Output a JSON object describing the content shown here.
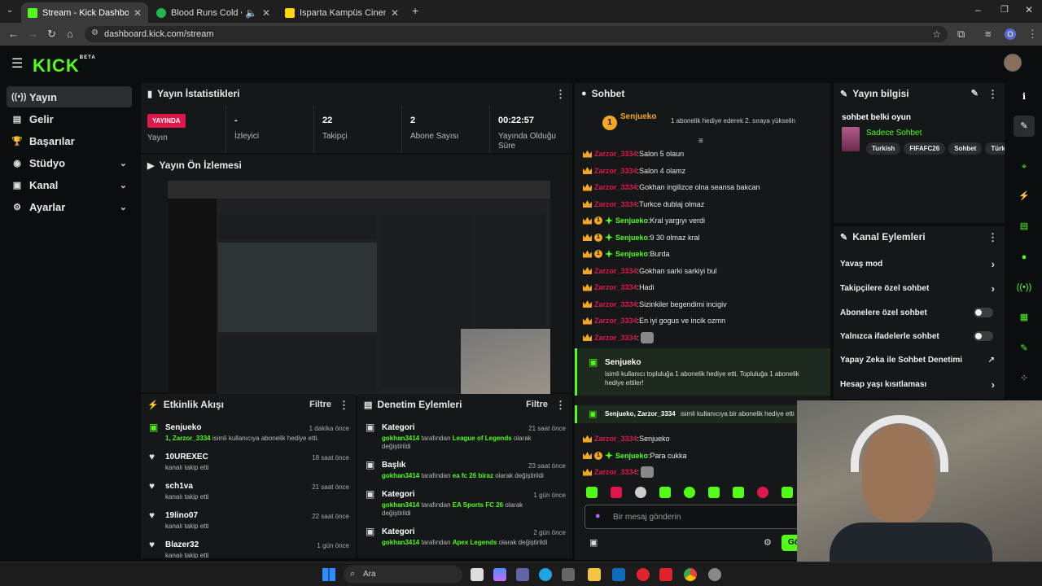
{
  "browser": {
    "tabs": [
      {
        "title": "Stream - Kick Dashboard",
        "color": "#53fc18"
      },
      {
        "title": "Blood Runs Cold • Jedi Mind",
        "color": "#1db954"
      },
      {
        "title": "Isparta Kampüs Cinema Pink | N",
        "color": "#f5d90a"
      }
    ],
    "url": "dashboard.kick.com/stream",
    "profile_initial": "O"
  },
  "kick": {
    "logo": "KICK",
    "logo_sup": "BETA"
  },
  "sidebar": {
    "items": [
      {
        "label": "Yayın"
      },
      {
        "label": "Gelir"
      },
      {
        "label": "Başarılar"
      },
      {
        "label": "Stüdyo"
      },
      {
        "label": "Kanal"
      },
      {
        "label": "Ayarlar"
      }
    ]
  },
  "stats": {
    "title": "Yayın İstatistikleri",
    "live_badge": "YAYINDA",
    "live_label": "Yayın",
    "cells": [
      {
        "value": "-",
        "label": "İzleyici"
      },
      {
        "value": "22",
        "label": "Takipçi"
      },
      {
        "value": "2",
        "label": "Abone Sayısı"
      },
      {
        "value": "00:22:57",
        "label": "Yayında Olduğu Süre"
      }
    ]
  },
  "preview": {
    "title": "Yayın Ön İzlemesi"
  },
  "activity": {
    "title": "Etkinlik Akışı",
    "filter": "Filtre",
    "items": [
      {
        "name": "Senjueko",
        "sub_green": "1, Zarzor_3334",
        "sub": "isimli kullanıcıya abonelik hediye etti.",
        "time": "1 dakika önce",
        "icon": "gift-icon"
      },
      {
        "name": "10UREXEC",
        "sub_green": "",
        "sub": "kanalı takip etti",
        "time": "18 saat önce",
        "icon": "heart-icon"
      },
      {
        "name": "sch1va",
        "sub_green": "",
        "sub": "kanalı takip etti",
        "time": "21 saat önce",
        "icon": "heart-icon"
      },
      {
        "name": "19lino07",
        "sub_green": "",
        "sub": "kanalı takip etti",
        "time": "22 saat önce",
        "icon": "heart-icon"
      },
      {
        "name": "Blazer32",
        "sub_green": "",
        "sub": "kanalı takip etti",
        "time": "1 gün önce",
        "icon": "heart-icon"
      }
    ]
  },
  "moderation": {
    "title": "Denetim Eylemleri",
    "filter": "Filtre",
    "items": [
      {
        "name": "Kategori",
        "user": "gokhan3414",
        "mid": "tarafından",
        "target": "League of Legends",
        "end": "olarak değiştirildi",
        "time": "21 saat önce"
      },
      {
        "name": "Başlık",
        "user": "gokhan3414",
        "mid": "tarafından",
        "target": "ea fc 26 biraz",
        "end": "olarak değiştirildi",
        "time": "23 saat önce"
      },
      {
        "name": "Kategori",
        "user": "gokhan3414",
        "mid": "tarafından",
        "target": "EA Sports FC 26",
        "end": "olarak değiştirildi",
        "time": "1 gün önce"
      },
      {
        "name": "Kategori",
        "user": "gokhan3414",
        "mid": "tarafından",
        "target": "Apex Legends",
        "end": "olarak değiştirildi",
        "time": "2 gün önce"
      }
    ]
  },
  "chat": {
    "title": "Sohbet",
    "pinned_user": "Senjueko",
    "pinned_rank": "1",
    "pinned_text": "1 abonelik hediye ederek 2. sıraya yükselin",
    "messages": [
      {
        "user": "Zarzor_3334",
        "type": "mod",
        "text": "Salon 5 olaun"
      },
      {
        "user": "Zarzor_3334",
        "type": "mod",
        "text": "Salon 4 olamz"
      },
      {
        "user": "Zarzor_3334",
        "type": "mod",
        "text": "Gokhan ingilizce olna seansa bakcan"
      },
      {
        "user": "Zarzor_3334",
        "type": "mod",
        "text": "Turkce dublaj olmaz"
      },
      {
        "user": "Senjueko",
        "type": "sub",
        "text": "Kral yargıyı verdi"
      },
      {
        "user": "Senjueko",
        "type": "sub",
        "text": "9 30 olmaz kral"
      },
      {
        "user": "Senjueko",
        "type": "sub",
        "text": "Burda"
      },
      {
        "user": "Zarzor_3334",
        "type": "mod",
        "text": "Gokhan sarki sarkiyi bul"
      },
      {
        "user": "Zarzor_3334",
        "type": "mod",
        "text": "Hadi"
      },
      {
        "user": "Zarzor_3334",
        "type": "mod",
        "text": "Sizinkiler begendimi incigiv"
      },
      {
        "user": "Zarzor_3334",
        "type": "mod",
        "text": "En iyi gogus ve incik ozmn"
      },
      {
        "user": "Zarzor_3334",
        "type": "mod",
        "text": ""
      }
    ],
    "gift_block": {
      "user": "Senjueko",
      "text": "isimli kullanıcı topluluğa 1 abonelik hediye etti. Topluluğa 1 abonelik hediye ettiler!"
    },
    "gift_line": {
      "users": "Senjueko, Zarzor_3334",
      "text": "isimli kullanıcıya bir abonelik hediye etti"
    },
    "messages2": [
      {
        "user": "Zarzor_3334",
        "type": "mod",
        "text": "Senjueko"
      },
      {
        "user": "Senjueko",
        "type": "sub",
        "text": "Para cukka"
      },
      {
        "user": "Zarzor_3334",
        "type": "mod",
        "text": ""
      }
    ],
    "input_placeholder": "Bir mesaj gönderin",
    "send_label": "Gö"
  },
  "stream_info": {
    "title": "Yayın bilgisi",
    "stream_title": "sohbet belki oyun",
    "category": "Sadece Sohbet",
    "tags": [
      "Turkish",
      "FIFAFC26",
      "Sohbet",
      "Türk"
    ]
  },
  "channel_actions": {
    "title": "Kanal Eylemleri",
    "rows": [
      {
        "label": "Yavaş mod",
        "control": "chevron"
      },
      {
        "label": "Takipçilere özel sohbet",
        "control": "chevron"
      },
      {
        "label": "Abonelere özel sohbet",
        "control": "toggle"
      },
      {
        "label": "Yalnızca ifadelerle sohbet",
        "control": "toggle"
      },
      {
        "label": "Yapay Zeka ile Sohbet Denetimi",
        "control": "external"
      },
      {
        "label": "Hesap yaşı kısıtlaması",
        "control": "chevron"
      }
    ]
  },
  "taskbar": {
    "search": "Ara"
  },
  "colors": {
    "accent": "#53fc18",
    "live": "#e0174a",
    "mod_name": "#e0174a",
    "sub_name": "#53fc18"
  }
}
